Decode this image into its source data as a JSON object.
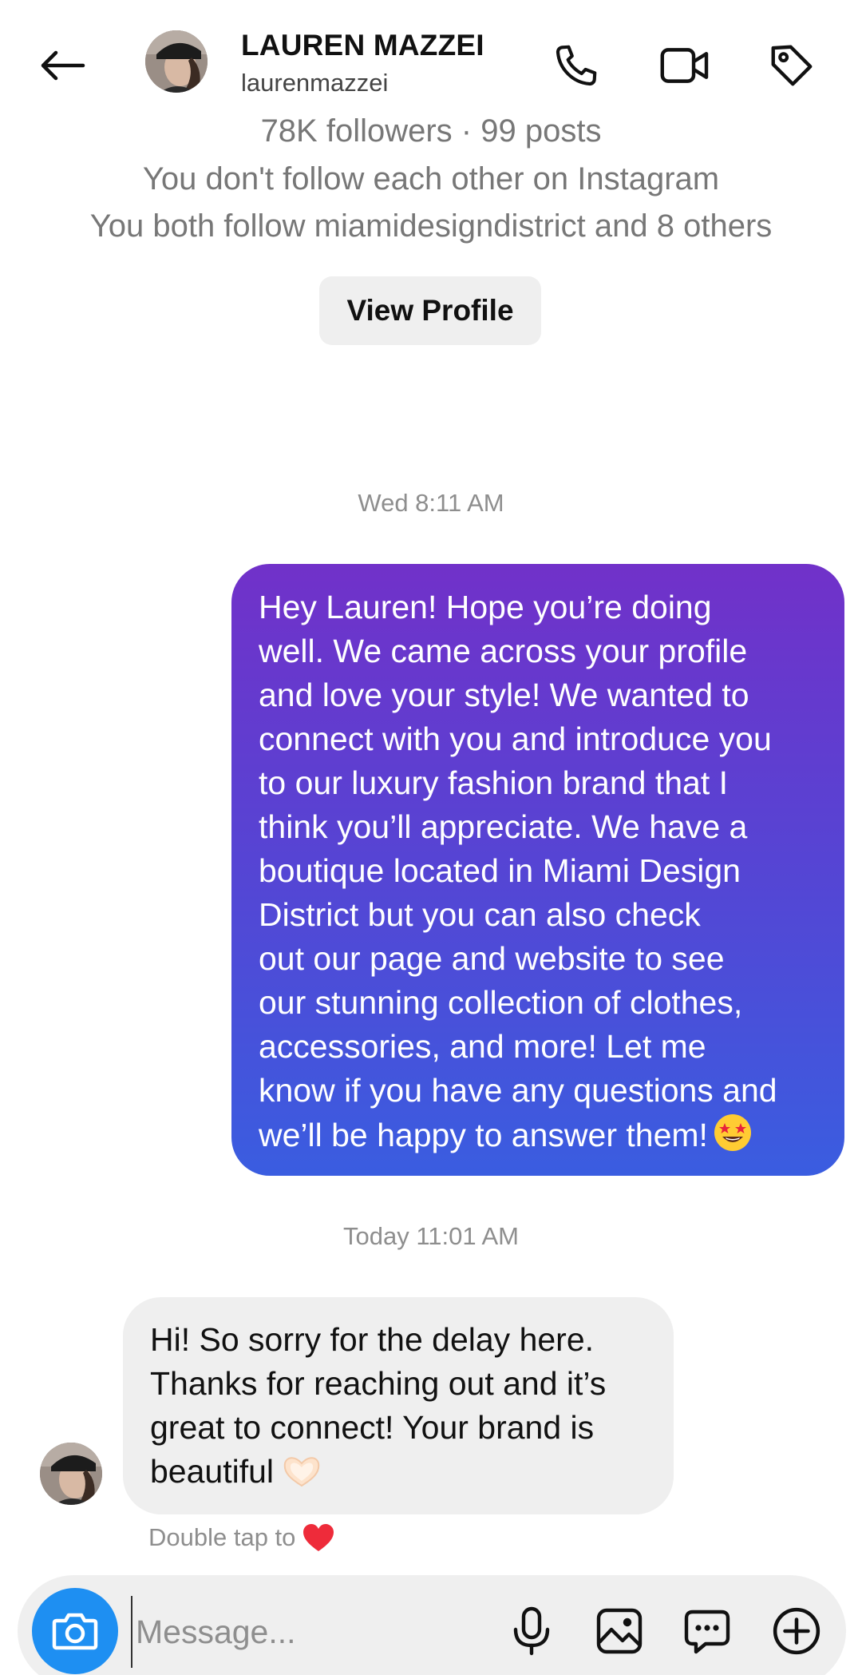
{
  "header": {
    "back_icon": "arrow-left-icon",
    "name": "LAUREN MAZZEI",
    "username": "laurenmazzei",
    "actions": [
      {
        "name": "call",
        "icon": "phone-icon"
      },
      {
        "name": "video",
        "icon": "video-camera-icon"
      },
      {
        "name": "tag",
        "icon": "tag-icon"
      }
    ]
  },
  "profile": {
    "stats": "78K followers · 99 posts",
    "follow_status": "You don't follow each other on Instagram",
    "mutuals": "You both follow miamidesigndistrict and 8 others",
    "view_profile_label": "View Profile"
  },
  "messages": {
    "timestamp_1": "Wed 8:11 AM",
    "outgoing_text": "Hey Lauren! Hope you’re doing\nwell. We came across your profile\nand love your style! We wanted to\nconnect with you and introduce you\nto our luxury fashion brand that I\nthink you’ll appreciate. We have a\nboutique located in Miami Design\nDistrict but you can also check\nout our page and website to see\nour stunning collection of clothes,\naccessories, and more! Let me\nknow if you have any questions and\nwe’ll be happy to answer them!",
    "outgoing_emoji": "star-struck-emoji",
    "timestamp_2": "Today 11:01 AM",
    "incoming_text": "Hi! So sorry for the delay here.\nThanks for reaching out and it’s\ngreat to connect! Your brand is\nbeautiful",
    "incoming_emoji": "heart-hands-emoji",
    "reaction_hint": "Double tap to",
    "reaction_icon": "red-heart-icon"
  },
  "composer": {
    "placeholder": "Message...",
    "value": "",
    "camera_icon": "camera-icon",
    "icons": [
      "microphone-icon",
      "image-icon",
      "sticker-chat-icon",
      "plus-circle-icon"
    ]
  },
  "colors": {
    "bubble_gradient_top": "#7131c9",
    "bubble_gradient_bottom": "#3a5de0",
    "camera_button": "#1e8ff2",
    "secondary_text": "#8e8e8e",
    "surface_gray": "#efefef"
  }
}
